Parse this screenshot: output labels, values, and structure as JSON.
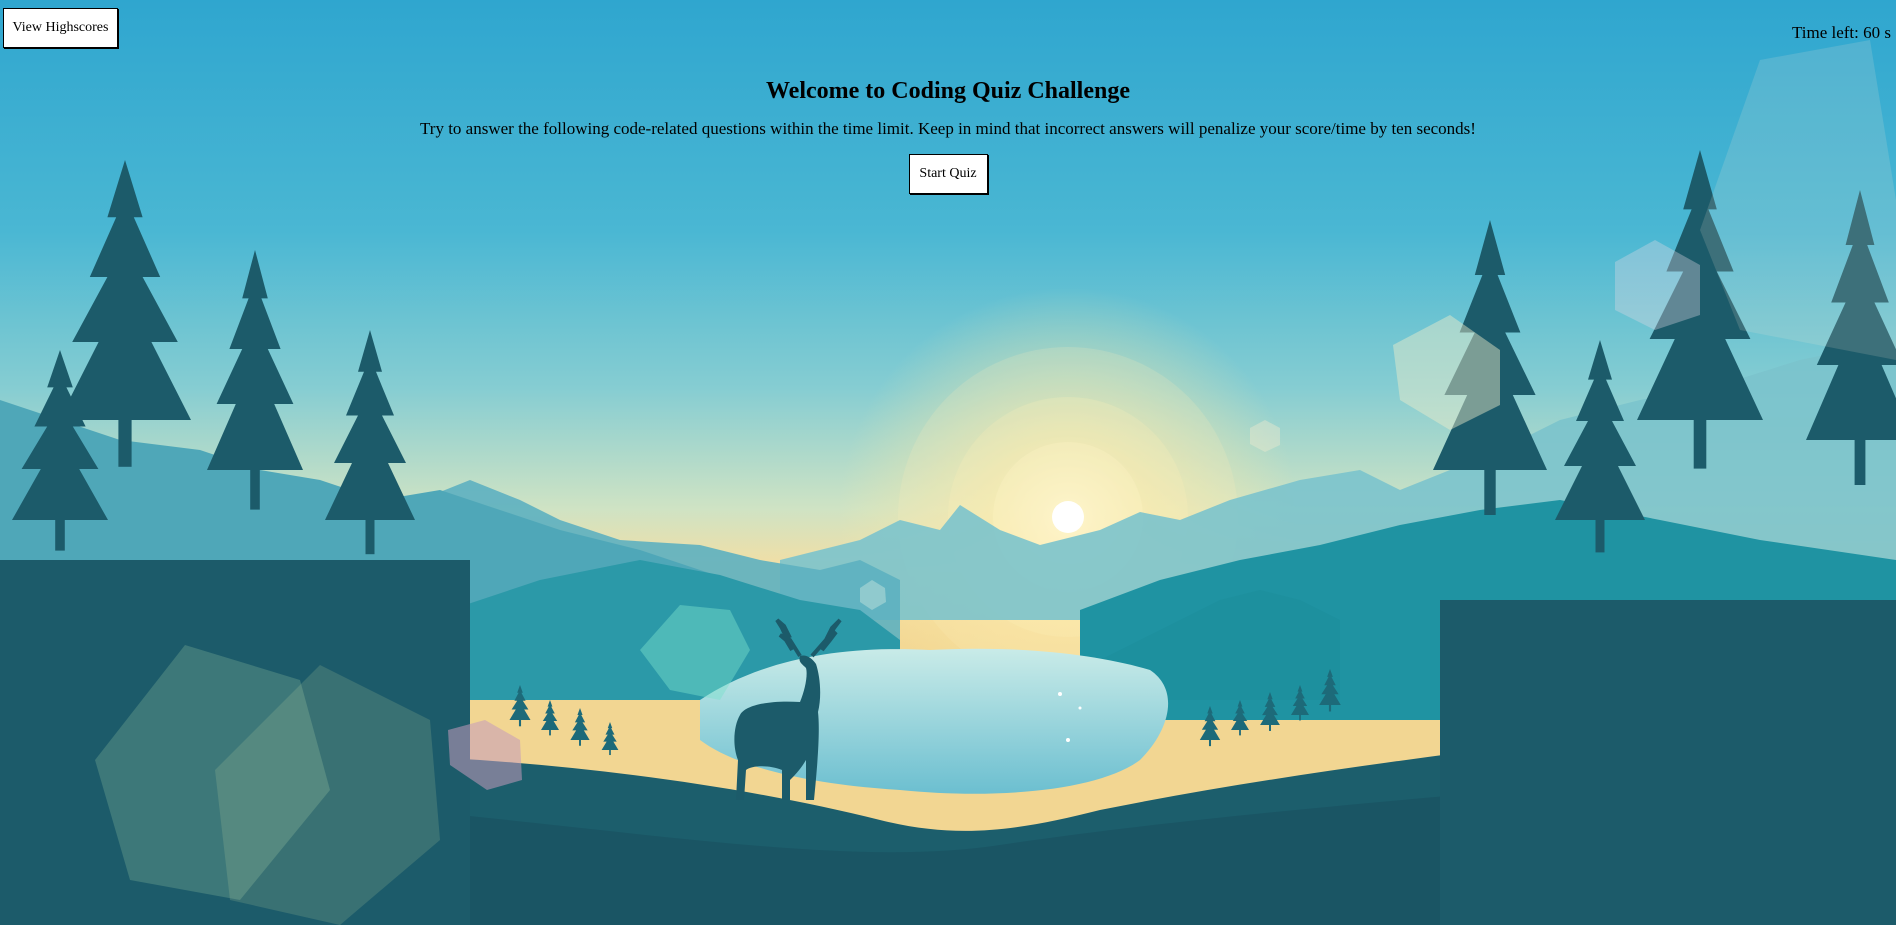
{
  "header": {
    "highscores_label": "View Highscores",
    "timer_text": "Time left: 60 s"
  },
  "intro": {
    "title": "Welcome to Coding Quiz Challenge",
    "description": "Try to answer the following code-related questions within the time limit. Keep in mind that incorrect answers will penalize your score/time by ten seconds!",
    "start_label": "Start Quiz"
  },
  "background": {
    "scene": "mountain-lake-deer-landscape",
    "sky_top": "#2fa6cf",
    "horizon_glow": "#f7dfa0",
    "forest_dark": "#1a5564",
    "lake": "#a6dbe3"
  }
}
